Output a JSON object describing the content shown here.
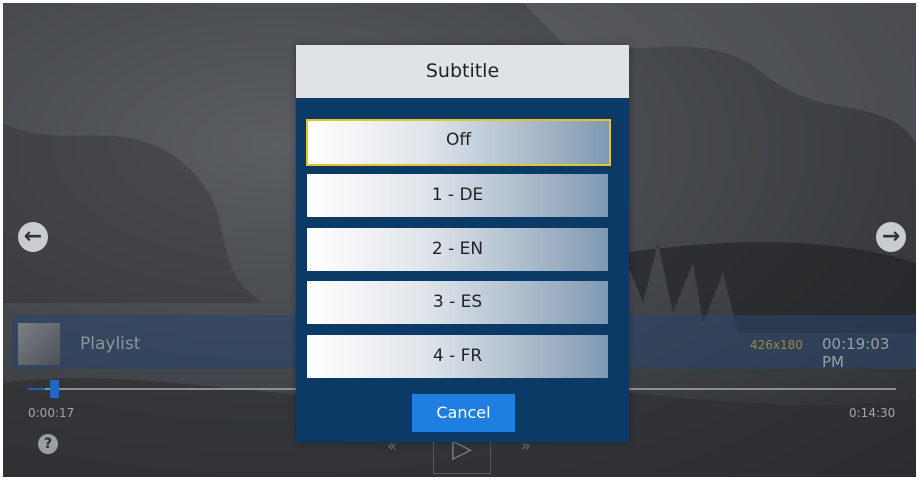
{
  "dialog": {
    "title": "Subtitle",
    "options": [
      {
        "label": "Off",
        "selected": true
      },
      {
        "label": "1 - DE",
        "selected": false
      },
      {
        "label": "2 - EN",
        "selected": false
      },
      {
        "label": "3 - ES",
        "selected": false
      },
      {
        "label": "4 - FR",
        "selected": false
      }
    ],
    "cancel_label": "Cancel"
  },
  "player": {
    "playlist_title": "Playlist",
    "resolution": "426x180",
    "clock": "00:19:03 PM",
    "elapsed": "0:00:17",
    "duration": "0:14:30",
    "progress_fraction": 0.02,
    "help_glyph": "?",
    "rewind_glyph": "«",
    "play_glyph": "▷",
    "forward_glyph": "»"
  },
  "icons": {
    "nav_left": "arrow-left-icon",
    "nav_right": "arrow-right-icon",
    "help": "question-icon"
  },
  "colors": {
    "dialog_bg": "#0c3a66",
    "header_bg": "#dfe3e8",
    "focus_border": "#e4c629",
    "cancel_bg": "#1f7fe0",
    "resolution_text": "#9c8a3a"
  }
}
